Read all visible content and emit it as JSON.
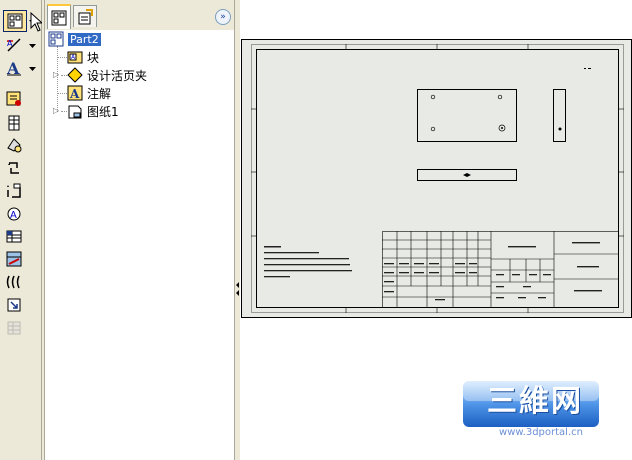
{
  "toolbar": {
    "tools": [
      "model-view",
      "annotation",
      "text",
      "note-tool",
      "table-tool",
      "balloon",
      "reorder",
      "auto-balloon",
      "surface-finish",
      "hole-table",
      "weld-table",
      "align",
      "insert-block",
      "bom-tool"
    ]
  },
  "feature_manager": {
    "tabs": [
      "feature-tree",
      "property-manager"
    ],
    "tree": {
      "root_label": "Part2",
      "items": [
        {
          "label": "块",
          "icon": "block-icon"
        },
        {
          "label": "设计活页夹",
          "icon": "design-binder-icon"
        },
        {
          "label": "注解",
          "icon": "annotations-icon"
        },
        {
          "label": "图纸1",
          "icon": "sheet-icon"
        }
      ]
    },
    "collapse_symbol": "»"
  },
  "watermark": {
    "main": "三維网",
    "url": "www.3dportal.cn"
  },
  "colors": {
    "selection": "#316ac5",
    "chrome": "#ece9d8",
    "sheet": "#e8ebe5"
  }
}
